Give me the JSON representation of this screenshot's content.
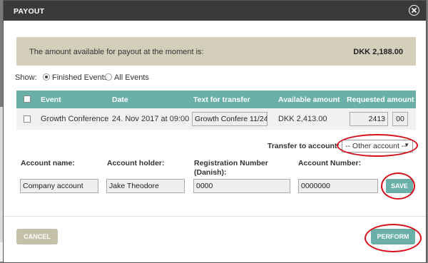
{
  "modal": {
    "title": "PAYOUT"
  },
  "amount": {
    "label": "The amount available for payout at the moment is:",
    "value": "DKK 2,188.00"
  },
  "show": {
    "label": "Show:",
    "options": [
      "Finished Events",
      "All Events"
    ],
    "selected": "Finished Events"
  },
  "table": {
    "headers": [
      "Event",
      "Date",
      "Text for transfer",
      "Available amount",
      "Requested amount"
    ],
    "rows": [
      {
        "event": "Growth Conference",
        "date": "24. Nov 2017 at 09:00",
        "transfer_text": "Growth Confere 11/24",
        "available": "DKK 2,413.00",
        "requested_main": "2413",
        "requested_decimals": "00"
      }
    ]
  },
  "transfer": {
    "label": "Transfer to account:",
    "selected": "-- Other account --"
  },
  "form": {
    "account_name_label": "Account name:",
    "account_name_value": "Company account",
    "account_holder_label": "Account holder:",
    "account_holder_value": "Jake Theodore",
    "registration_label": "Registration Number (Danish):",
    "registration_value": "0000",
    "account_number_label": "Account Number:",
    "account_number_value": "0000000",
    "save_label": "SAVE"
  },
  "footer": {
    "cancel_label": "CANCEL",
    "perform_label": "PERFORM"
  },
  "colors": {
    "header_bg": "#3a3a3a",
    "teal": "#6ab0a8",
    "khaki": "#d3cfbb",
    "annotation_red": "#d6101a"
  }
}
